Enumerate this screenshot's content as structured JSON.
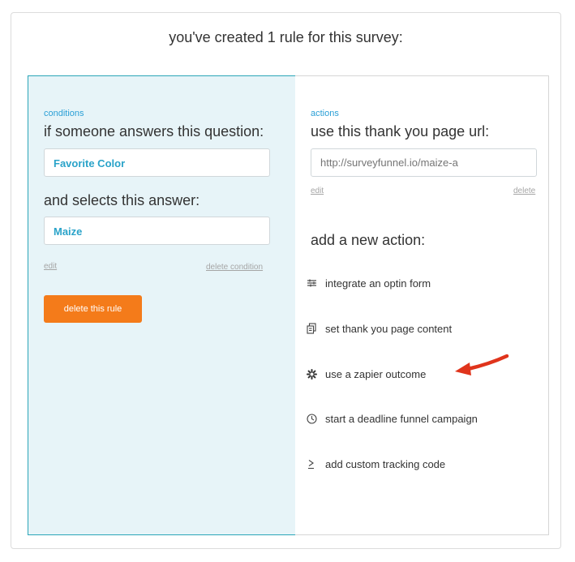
{
  "header": {
    "title": "you've created 1 rule for this survey:"
  },
  "conditions": {
    "section_label": "conditions",
    "question_heading": "if someone answers this question:",
    "question_value": "Favorite Color",
    "answer_heading": "and selects this answer:",
    "answer_value": "Maize",
    "edit_label": "edit",
    "delete_condition_label": "delete condition",
    "delete_rule_label": "delete this rule"
  },
  "actions": {
    "section_label": "actions",
    "thank_you_heading": "use this thank you page url:",
    "url_placeholder": "http://surveyfunnel.io/maize-a",
    "url_value": "",
    "edit_label": "edit",
    "delete_label": "delete",
    "add_heading": "add a new action:",
    "items": [
      {
        "label": "integrate an optin form",
        "icon": "sliders-icon"
      },
      {
        "label": "set thank you page content",
        "icon": "pages-icon"
      },
      {
        "label": "use a zapier outcome",
        "icon": "zapier-icon"
      },
      {
        "label": "start a deadline funnel campaign",
        "icon": "clock-icon"
      },
      {
        "label": "add custom tracking code",
        "icon": "code-icon"
      }
    ]
  },
  "colors": {
    "accent": "#2a9fd6",
    "button": "#f47b1a",
    "panel_bg": "#e7f4f8",
    "panel_border": "#2ba6b8",
    "arrow": "#e0341c"
  }
}
